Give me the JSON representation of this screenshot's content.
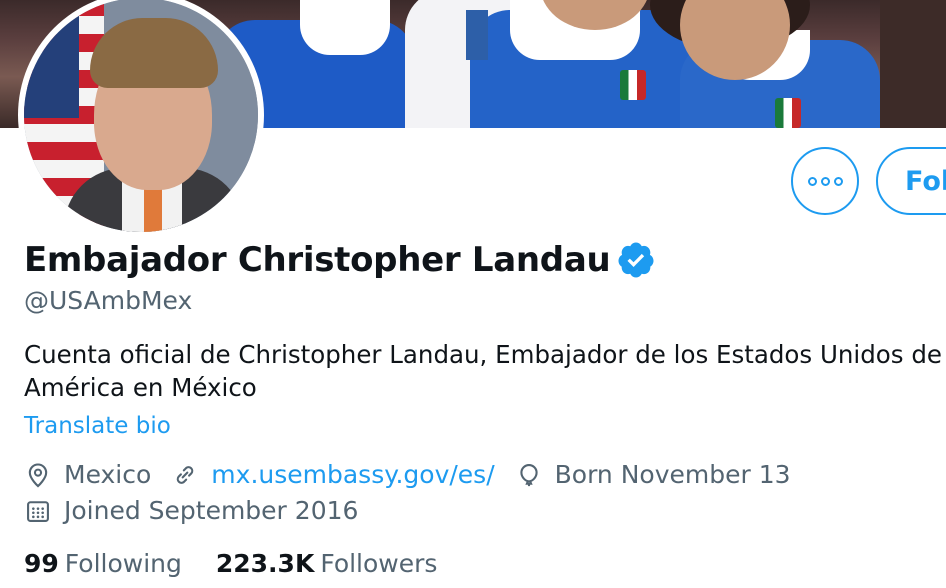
{
  "profile": {
    "name": "Embajador Christopher Landau",
    "handle": "@USAmbMex",
    "verified": true,
    "bio_line1": "Cuenta oficial de Christopher Landau, Embajador de los Estados Unidos de",
    "bio_line2": "América en México",
    "translate_label": "Translate bio",
    "location": "Mexico",
    "website": "mx.usembassy.gov/es/",
    "birthday": "Born November 13",
    "joined": "Joined September 2016",
    "following_count": "99",
    "following_label": "Following",
    "followers_count": "223.3K",
    "followers_label": "Followers"
  },
  "actions": {
    "follow_label": "Follow"
  },
  "icons": {
    "more": "more-options-icon",
    "verified": "verified-badge-icon",
    "location": "location-pin-icon",
    "link": "link-icon",
    "birthday": "balloon-icon",
    "calendar": "calendar-icon"
  },
  "colors": {
    "accent": "#1d9bf0",
    "secondary_text": "#536471",
    "primary_text": "#0f1419"
  }
}
